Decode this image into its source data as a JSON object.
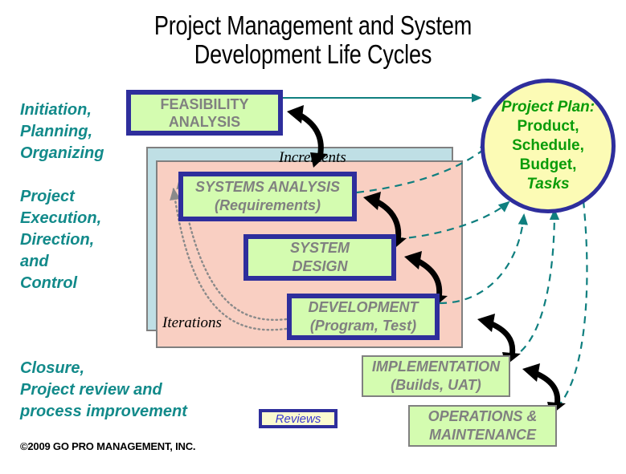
{
  "title": {
    "line1": "Project Management and System",
    "line2": "Development Life Cycles"
  },
  "phases": [
    {
      "name": "initiation",
      "text": "Initiation,\nPlanning,\nOrganizing"
    },
    {
      "name": "execution",
      "text": "Project\nExecution,\nDirection,\nand\nControl"
    },
    {
      "name": "closure",
      "text": "Closure,\nProject review and\nprocess improvement"
    }
  ],
  "copyright": "©2009 GO PRO MANAGEMENT, INC.",
  "panels": {
    "increments_label": "Increments",
    "iterations_label": "Iterations"
  },
  "boxes": {
    "feasibility": "FEASIBILITY\nANALYSIS",
    "analysis": "SYSTEMS ANALYSIS\n(Requirements)",
    "design": "SYSTEM\nDESIGN",
    "development": "DEVELOPMENT\n(Program, Test)",
    "implementation": "IMPLEMENTATION\n(Builds, UAT)",
    "operations": "OPERATIONS &\nMAINTENANCE"
  },
  "legend": {
    "reviews": "Reviews"
  },
  "project_plan": {
    "line1": "Project Plan:",
    "line2": "Product,",
    "line3": "Schedule,",
    "line4": "Budget,",
    "line5": "Tasks"
  },
  "colors": {
    "teal_text": "#128a8a",
    "box_fill": "#d4fcb0",
    "box_border": "#2e2e9c",
    "box_text": "#808080",
    "increments_panel": "#bfdfe5",
    "iterations_panel": "#f9cfc2",
    "circle_fill": "#fcfbb5",
    "circle_text": "#0a9c0a",
    "legend_fill": "#fcfbd0",
    "dashed_arrow": "#0f7f7f",
    "dotted_arrow": "#8a8a8a",
    "solid_arrow": "#000000"
  }
}
